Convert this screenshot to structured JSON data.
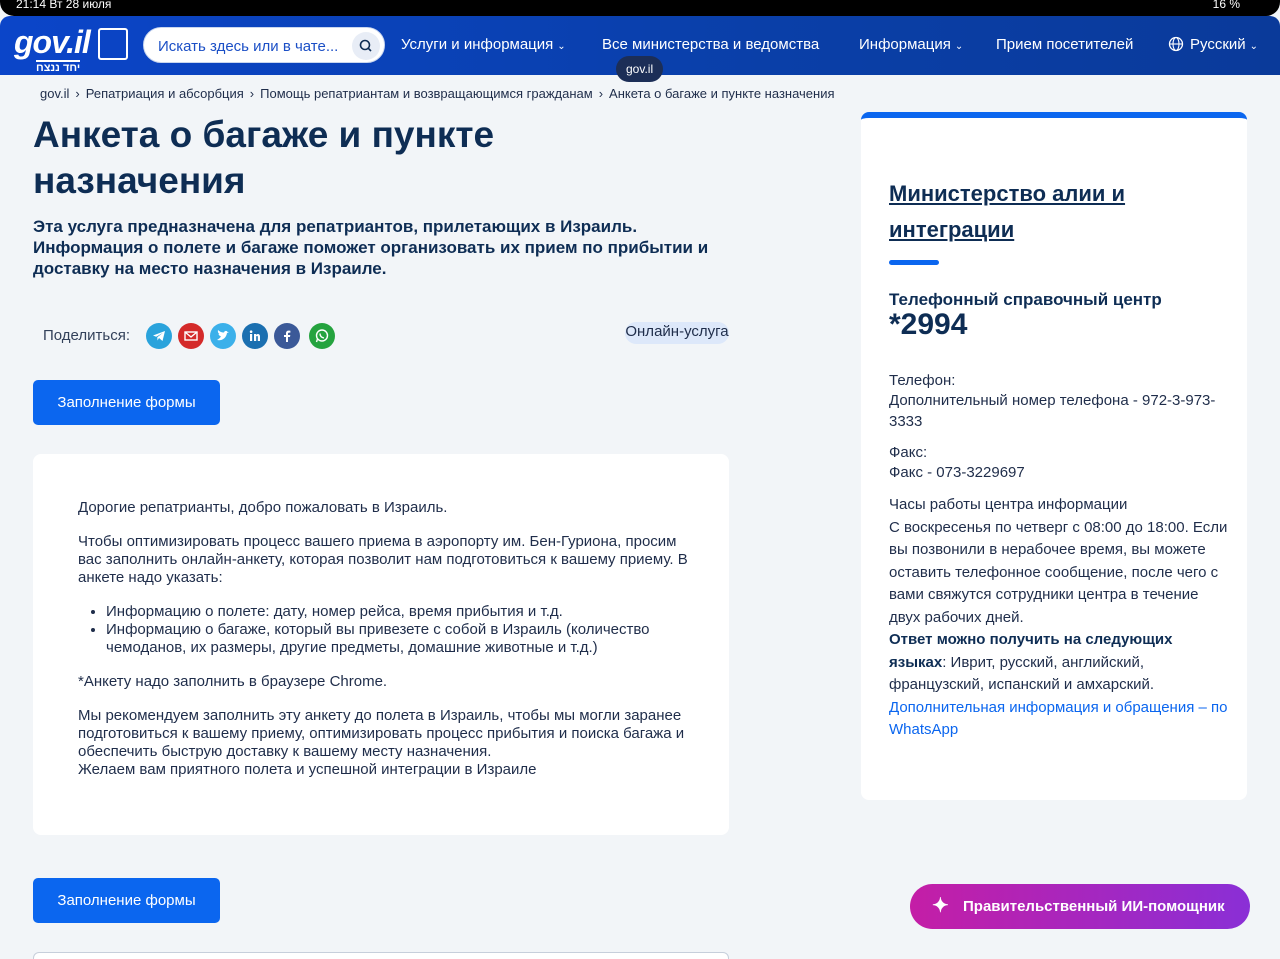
{
  "status": {
    "time": "21:14",
    "date": "Вт 28 июля",
    "battery": "16 %"
  },
  "header": {
    "logo_text": "gov.il",
    "logo_sub": "יחד ננצח",
    "search_placeholder": "Искать здесь или в чате...",
    "nav": [
      {
        "label": "Услуги и информация"
      },
      {
        "label": "Все министерства и ведомства"
      },
      {
        "label": "Информация"
      },
      {
        "label": "Прием посетителей"
      },
      {
        "label": "Русский"
      }
    ],
    "tooltip": "gov.il"
  },
  "breadcrumbs": [
    "gov.il",
    "Репатриация и абсорбция",
    "Помощь репатриантам и возвращающимся гражданам",
    "Анкета о багаже и пункте назначения"
  ],
  "page": {
    "title": "Анкета о багаже и пункте назначения",
    "lead": "Эта услуга предназначена для репатриантов, прилетающих в Израиль. Информация о полете и багаже поможет организовать их прием по прибытии и доставку на место назначения в Израиле.",
    "share_label": "Поделиться:",
    "online_badge": "Онлайн-услуга",
    "fill_button": "Заполнение формы",
    "fill_button_2": "Заполнение формы"
  },
  "card": {
    "p1": "Дорогие репатрианты, добро пожаловать в Израиль.",
    "p2": "Чтобы оптимизировать процесс вашего приема в аэропорту им. Бен-Гуриона, просим вас заполнить онлайн-анкету, которая позволит нам подготовиться к вашему приему. В анкете надо указать:",
    "li1": "Информацию о полете: дату, номер рейса, время прибытия и т.д.",
    "li2": "Информацию о багаже, который вы привезете с собой в Израиль (количество чемоданов, их размеры, другие предметы, домашние животные и т.д.)",
    "p3": "*Анкету надо заполнить в браузере Chrome.",
    "p4": "Мы рекомендуем заполнить эту анкету до полета в Израиль, чтобы мы могли заранее подготовиться к вашему приему, оптимизировать процесс прибытия и поиска багажа и обеспечить быструю доставку к вашему месту назначения.",
    "p5": "Желаем вам приятного полета и успешной интеграции в Израиле"
  },
  "sidebar": {
    "ministry": "Министерство алии и интеграции",
    "phone_center_label": "Телефонный справочный центр",
    "phone_center_number": "*2994",
    "phone_label": "Телефон:",
    "phone_value": "Дополнительный номер телефона - 972-3-973-3333",
    "fax_label": "Факс:",
    "fax_value": "Факс - 073-3229697",
    "hours_title": "Часы работы центра информации",
    "hours_text": "С воскресенья по четверг с 08:00 до 18:00. Если вы позвонили в нерабочее время, вы можете оставить телефонное сообщение, после чего с вами свяжутся сотрудники центра в течение двух рабочих дней.",
    "languages_bold": "Ответ можно получить на следующих языках",
    "languages_text": ": Иврит, русский, английский, французский, испанский и амхарский.",
    "whatsapp_link": "Дополнительная информация и обращения – по WhatsApp"
  },
  "ai_button": "Правительственный ИИ-помощник",
  "colors": {
    "brand": "#0b45c9",
    "button": "#0b66ef",
    "ai_start": "#c41ea6",
    "ai_end": "#8a2fd6"
  },
  "share_icons": [
    "telegram-icon",
    "email-icon",
    "twitter-icon",
    "linkedin-icon",
    "facebook-icon",
    "whatsapp-icon"
  ]
}
